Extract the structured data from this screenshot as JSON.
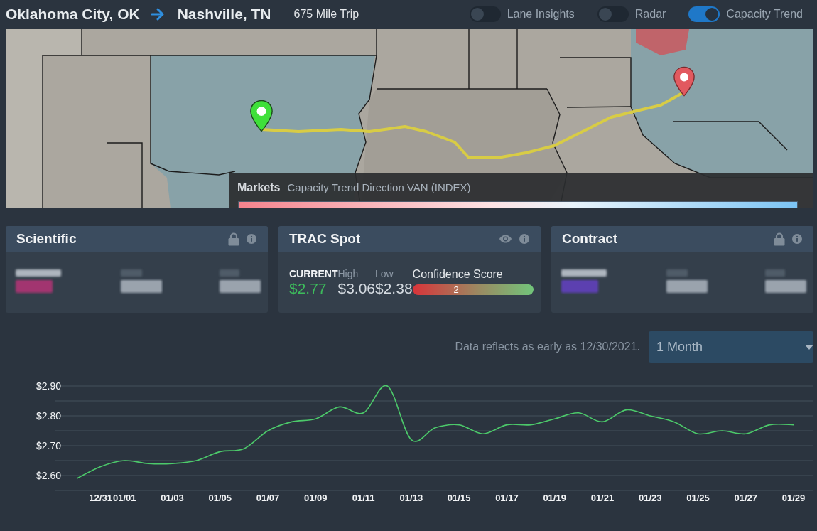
{
  "route": {
    "origin": "Oklahoma City, OK",
    "destination": "Nashville, TN",
    "distance": "675 Mile Trip"
  },
  "toggles": [
    {
      "label": "Lane Insights",
      "on": false
    },
    {
      "label": "Radar",
      "on": false
    },
    {
      "label": "Capacity Trend",
      "on": true
    }
  ],
  "map": {
    "legend": {
      "title": "Markets",
      "subtitle": "Capacity Trend Direction VAN (INDEX)"
    }
  },
  "rate_cards": [
    {
      "title": "Scientific",
      "locked": true,
      "color": "#a2346f"
    },
    {
      "title": "TRAC Spot",
      "locked": false,
      "color": "#3dbb5c",
      "stats": [
        {
          "label": "CURRENT",
          "value": "$2.77"
        },
        {
          "label": "High",
          "value": "$3.06"
        },
        {
          "label": "Low",
          "value": "$2.38"
        }
      ],
      "confidence": {
        "label": "Confidence Score",
        "score": "2"
      }
    },
    {
      "title": "Contract",
      "locked": true,
      "color": "#5b3fb0"
    }
  ],
  "history": {
    "note": "Data reflects as early as 12/30/2021.",
    "range": {
      "value": "1 Month"
    },
    "chart_data": {
      "type": "line",
      "categories": [
        null,
        "12/31",
        "01/01",
        null,
        "01/03",
        null,
        "01/05",
        null,
        "01/07",
        null,
        "01/09",
        null,
        "01/11",
        null,
        "01/13",
        null,
        "01/15",
        null,
        "01/17",
        null,
        "01/19",
        null,
        "01/21",
        null,
        "01/23",
        null,
        "01/25",
        null,
        "01/27",
        null,
        "01/29"
      ],
      "series": [
        {
          "color": "#4cc96a",
          "values": [
            2.59,
            2.63,
            2.65,
            2.64,
            2.64,
            2.65,
            2.68,
            2.69,
            2.75,
            2.78,
            2.79,
            2.83,
            2.81,
            2.9,
            2.72,
            2.76,
            2.77,
            2.74,
            2.77,
            2.77,
            2.79,
            2.81,
            2.78,
            2.82,
            2.8,
            2.78,
            2.74,
            2.75,
            2.74,
            2.77,
            2.77
          ]
        }
      ],
      "ylim": [
        2.55,
        2.9
      ],
      "yticks": [
        {
          "value": 2.9,
          "label": "$2.90"
        },
        {
          "value": 2.8,
          "label": "$2.80"
        },
        {
          "value": 2.7,
          "label": "$2.70"
        },
        {
          "value": 2.6,
          "label": "$2.60"
        }
      ],
      "grid": true
    }
  }
}
